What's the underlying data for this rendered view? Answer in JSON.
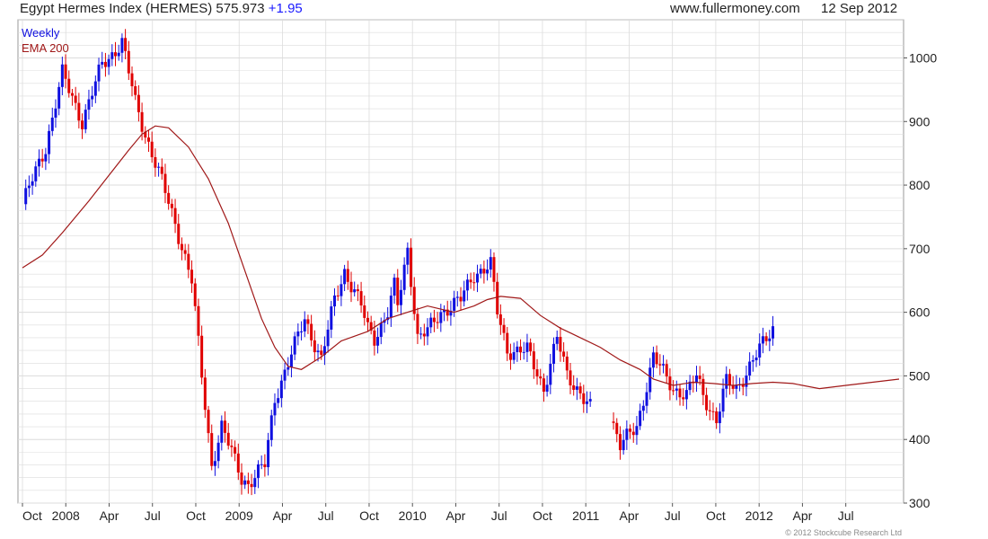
{
  "header": {
    "title": "Egypt Hermes Index (HERMES) 575.973",
    "change": "+1.95",
    "site": "www.fullermoney.com",
    "date": "12 Sep 2012"
  },
  "footer": {
    "copyright": "© 2012 Stockcube Research Ltd"
  },
  "colors": {
    "up": "#1010e0",
    "down": "#e00000",
    "ema": "#a01818",
    "grid": "#dcdcdc"
  },
  "chart_data": {
    "type": "candlestick",
    "ylim": [
      300,
      1060
    ],
    "yticks": [
      300,
      400,
      500,
      600,
      700,
      800,
      900,
      1000
    ],
    "xlabels": [
      "Oct",
      "2008",
      "Apr",
      "Jul",
      "Oct",
      "2009",
      "Apr",
      "Jul",
      "Oct",
      "2010",
      "Apr",
      "Jul",
      "Oct",
      "2011",
      "Apr",
      "Jul",
      "Oct",
      "2012",
      "Apr",
      "Jul"
    ],
    "grid": true,
    "legend": {
      "position": "top-left",
      "entries": [
        {
          "name": "Weekly",
          "color": "#1010e0"
        },
        {
          "name": "EMA 200",
          "color": "#a01818"
        }
      ]
    },
    "series": [
      {
        "name": "Weekly",
        "kind": "close-keypoints",
        "weeks": [
          0,
          7,
          12,
          18,
          24,
          26,
          30,
          34,
          37,
          42,
          46,
          51,
          54,
          57,
          60,
          66,
          68,
          73,
          76,
          80,
          85,
          90,
          94,
          97,
          102,
          104,
          106,
          110,
          112,
          113,
          116,
          119,
          122,
          126,
          132,
          136,
          141,
          143,
          146,
          152,
          157,
          161,
          164,
          168,
          171,
          174,
          177,
          180,
          185,
          190,
          196,
          200,
          203,
          205,
          209,
          212,
          215,
          223,
          226,
          232,
          235,
          240,
          242,
          247,
          251,
          255,
          258,
          261,
          264
        ],
        "close": [
          770,
          860,
          975,
          900,
          990,
          1000,
          1025,
          930,
          880,
          805,
          740,
          650,
          500,
          360,
          420,
          340,
          330,
          360,
          465,
          520,
          590,
          525,
          620,
          665,
          610,
          575,
          560,
          600,
          640,
          610,
          700,
          560,
          570,
          600,
          620,
          660,
          675,
          600,
          540,
          540,
          480,
          560,
          500,
          475,
          450,
          420,
          440,
          390,
          420,
          530,
          480,
          470,
          500,
          470,
          430,
          490,
          480,
          550,
          576
        ],
        "note": ""
      },
      {
        "name": "EMA 200",
        "kind": "line",
        "weeks": [
          0,
          6,
          12,
          20,
          26,
          32,
          36,
          40,
          44,
          50,
          56,
          62,
          68,
          72,
          76,
          80,
          84,
          90,
          96,
          104,
          110,
          116,
          122,
          130,
          136,
          140,
          144,
          150,
          156,
          162,
          168,
          174,
          180,
          186,
          190,
          196,
          202,
          208,
          214,
          220,
          226,
          232,
          240,
          248,
          256,
          264
        ],
        "values": [
          670,
          690,
          725,
          775,
          815,
          855,
          880,
          893,
          890,
          860,
          810,
          740,
          650,
          590,
          545,
          515,
          510,
          530,
          555,
          570,
          590,
          600,
          610,
          600,
          610,
          620,
          625,
          622,
          595,
          575,
          560,
          545,
          525,
          510,
          495,
          485,
          490,
          488,
          485,
          488,
          490,
          488,
          480,
          485,
          490,
          495
        ]
      }
    ]
  }
}
